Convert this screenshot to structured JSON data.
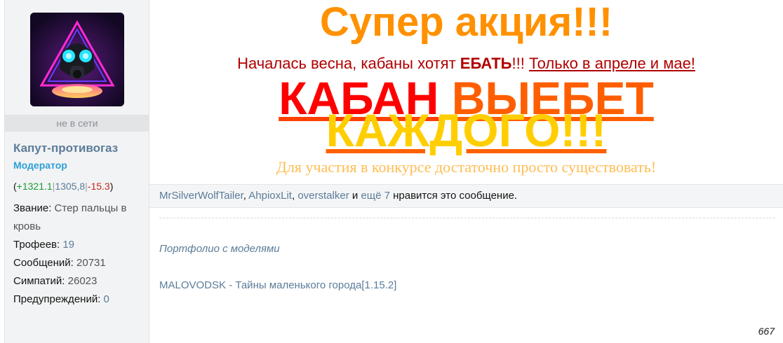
{
  "user": {
    "avatar_alt": "gas mask avatar",
    "status": "не в сети",
    "name": "Капут-противогаз",
    "role": "Модератор",
    "reputation": {
      "open": "(",
      "positive": "+1321.1",
      "neutral": "1305,8",
      "negative": "-15.3",
      "close": ")"
    },
    "stats": [
      {
        "label": "Звание:",
        "value": "Стер пальцы в кровь"
      },
      {
        "label": "Трофеев:",
        "value": "19"
      },
      {
        "label": "Сообщений:",
        "value": "20731"
      },
      {
        "label": "Симпатий:",
        "value": "26023"
      },
      {
        "label": "Предупреждений:",
        "value": "0"
      }
    ]
  },
  "post": {
    "title": "Супер акция!!!",
    "subtitle": {
      "pre": "Началась весна, кабаны хотят ",
      "bold": "ЕБАТЬ",
      "mid": "!!! ",
      "link": "Только в апреле и мае!"
    },
    "headline1": {
      "part1": "КАБАН",
      "part2": "ВЫЕБЕТ"
    },
    "headline2": "КАЖДОГО!!!",
    "contest": "Для участия в конкурсе достаточно просто существовать!",
    "colors": {
      "title": "#ff9100",
      "red": "#ff0000",
      "yellow": "#ffce00",
      "link": "#5b7c99"
    }
  },
  "likes": {
    "users": [
      "MrSilverWolfTailer",
      "AhpioxLit",
      "overstalker"
    ],
    "sep1": ", ",
    "sep2": ", ",
    "and": " и ",
    "more": "ещё 7",
    "suffix": " нравится это сообщение."
  },
  "signature": {
    "portfolio": "Портфолио с моделями",
    "project": "MALOVODSK - Тайны маленького города[1.15.2]"
  },
  "post_number": "667"
}
